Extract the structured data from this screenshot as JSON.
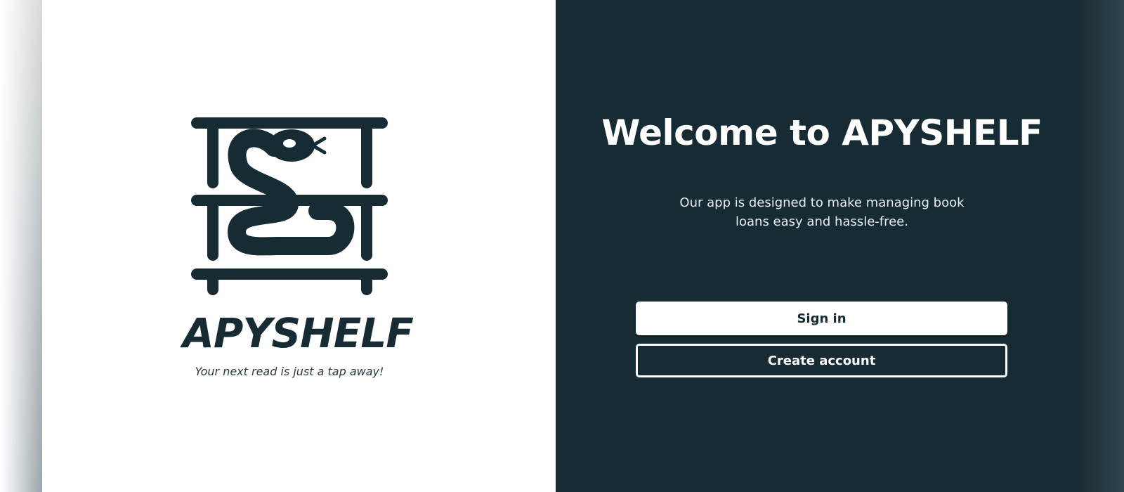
{
  "brand": {
    "name": "APYSHELF",
    "tagline": "Your next read is just a tap away!"
  },
  "welcome": {
    "title": "Welcome to APYSHELF",
    "description": "Our app is designed to make managing book loans easy and hassle-free."
  },
  "actions": {
    "sign_in_label": "Sign in",
    "create_account_label": "Create account"
  },
  "icons": {
    "logo": "snake-on-bookshelf-icon"
  },
  "colors": {
    "primary_dark": "#172b35",
    "white": "#ffffff"
  }
}
